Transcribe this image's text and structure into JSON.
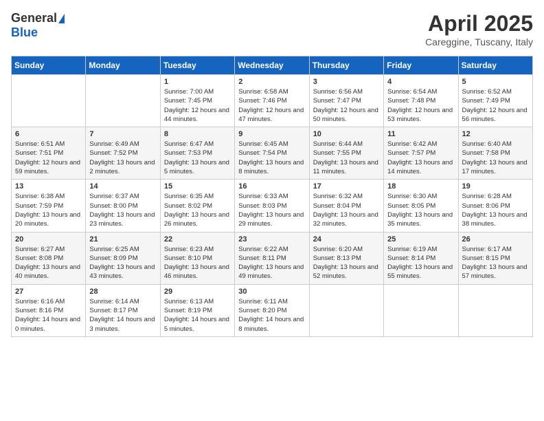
{
  "header": {
    "logo_general": "General",
    "logo_blue": "Blue",
    "title": "April 2025",
    "location": "Careggine, Tuscany, Italy"
  },
  "weekdays": [
    "Sunday",
    "Monday",
    "Tuesday",
    "Wednesday",
    "Thursday",
    "Friday",
    "Saturday"
  ],
  "weeks": [
    [
      {
        "day": "",
        "sunrise": "",
        "sunset": "",
        "daylight": ""
      },
      {
        "day": "",
        "sunrise": "",
        "sunset": "",
        "daylight": ""
      },
      {
        "day": "1",
        "sunrise": "Sunrise: 7:00 AM",
        "sunset": "Sunset: 7:45 PM",
        "daylight": "Daylight: 12 hours and 44 minutes."
      },
      {
        "day": "2",
        "sunrise": "Sunrise: 6:58 AM",
        "sunset": "Sunset: 7:46 PM",
        "daylight": "Daylight: 12 hours and 47 minutes."
      },
      {
        "day": "3",
        "sunrise": "Sunrise: 6:56 AM",
        "sunset": "Sunset: 7:47 PM",
        "daylight": "Daylight: 12 hours and 50 minutes."
      },
      {
        "day": "4",
        "sunrise": "Sunrise: 6:54 AM",
        "sunset": "Sunset: 7:48 PM",
        "daylight": "Daylight: 12 hours and 53 minutes."
      },
      {
        "day": "5",
        "sunrise": "Sunrise: 6:52 AM",
        "sunset": "Sunset: 7:49 PM",
        "daylight": "Daylight: 12 hours and 56 minutes."
      }
    ],
    [
      {
        "day": "6",
        "sunrise": "Sunrise: 6:51 AM",
        "sunset": "Sunset: 7:51 PM",
        "daylight": "Daylight: 12 hours and 59 minutes."
      },
      {
        "day": "7",
        "sunrise": "Sunrise: 6:49 AM",
        "sunset": "Sunset: 7:52 PM",
        "daylight": "Daylight: 13 hours and 2 minutes."
      },
      {
        "day": "8",
        "sunrise": "Sunrise: 6:47 AM",
        "sunset": "Sunset: 7:53 PM",
        "daylight": "Daylight: 13 hours and 5 minutes."
      },
      {
        "day": "9",
        "sunrise": "Sunrise: 6:45 AM",
        "sunset": "Sunset: 7:54 PM",
        "daylight": "Daylight: 13 hours and 8 minutes."
      },
      {
        "day": "10",
        "sunrise": "Sunrise: 6:44 AM",
        "sunset": "Sunset: 7:55 PM",
        "daylight": "Daylight: 13 hours and 11 minutes."
      },
      {
        "day": "11",
        "sunrise": "Sunrise: 6:42 AM",
        "sunset": "Sunset: 7:57 PM",
        "daylight": "Daylight: 13 hours and 14 minutes."
      },
      {
        "day": "12",
        "sunrise": "Sunrise: 6:40 AM",
        "sunset": "Sunset: 7:58 PM",
        "daylight": "Daylight: 13 hours and 17 minutes."
      }
    ],
    [
      {
        "day": "13",
        "sunrise": "Sunrise: 6:38 AM",
        "sunset": "Sunset: 7:59 PM",
        "daylight": "Daylight: 13 hours and 20 minutes."
      },
      {
        "day": "14",
        "sunrise": "Sunrise: 6:37 AM",
        "sunset": "Sunset: 8:00 PM",
        "daylight": "Daylight: 13 hours and 23 minutes."
      },
      {
        "day": "15",
        "sunrise": "Sunrise: 6:35 AM",
        "sunset": "Sunset: 8:02 PM",
        "daylight": "Daylight: 13 hours and 26 minutes."
      },
      {
        "day": "16",
        "sunrise": "Sunrise: 6:33 AM",
        "sunset": "Sunset: 8:03 PM",
        "daylight": "Daylight: 13 hours and 29 minutes."
      },
      {
        "day": "17",
        "sunrise": "Sunrise: 6:32 AM",
        "sunset": "Sunset: 8:04 PM",
        "daylight": "Daylight: 13 hours and 32 minutes."
      },
      {
        "day": "18",
        "sunrise": "Sunrise: 6:30 AM",
        "sunset": "Sunset: 8:05 PM",
        "daylight": "Daylight: 13 hours and 35 minutes."
      },
      {
        "day": "19",
        "sunrise": "Sunrise: 6:28 AM",
        "sunset": "Sunset: 8:06 PM",
        "daylight": "Daylight: 13 hours and 38 minutes."
      }
    ],
    [
      {
        "day": "20",
        "sunrise": "Sunrise: 6:27 AM",
        "sunset": "Sunset: 8:08 PM",
        "daylight": "Daylight: 13 hours and 40 minutes."
      },
      {
        "day": "21",
        "sunrise": "Sunrise: 6:25 AM",
        "sunset": "Sunset: 8:09 PM",
        "daylight": "Daylight: 13 hours and 43 minutes."
      },
      {
        "day": "22",
        "sunrise": "Sunrise: 6:23 AM",
        "sunset": "Sunset: 8:10 PM",
        "daylight": "Daylight: 13 hours and 46 minutes."
      },
      {
        "day": "23",
        "sunrise": "Sunrise: 6:22 AM",
        "sunset": "Sunset: 8:11 PM",
        "daylight": "Daylight: 13 hours and 49 minutes."
      },
      {
        "day": "24",
        "sunrise": "Sunrise: 6:20 AM",
        "sunset": "Sunset: 8:13 PM",
        "daylight": "Daylight: 13 hours and 52 minutes."
      },
      {
        "day": "25",
        "sunrise": "Sunrise: 6:19 AM",
        "sunset": "Sunset: 8:14 PM",
        "daylight": "Daylight: 13 hours and 55 minutes."
      },
      {
        "day": "26",
        "sunrise": "Sunrise: 6:17 AM",
        "sunset": "Sunset: 8:15 PM",
        "daylight": "Daylight: 13 hours and 57 minutes."
      }
    ],
    [
      {
        "day": "27",
        "sunrise": "Sunrise: 6:16 AM",
        "sunset": "Sunset: 8:16 PM",
        "daylight": "Daylight: 14 hours and 0 minutes."
      },
      {
        "day": "28",
        "sunrise": "Sunrise: 6:14 AM",
        "sunset": "Sunset: 8:17 PM",
        "daylight": "Daylight: 14 hours and 3 minutes."
      },
      {
        "day": "29",
        "sunrise": "Sunrise: 6:13 AM",
        "sunset": "Sunset: 8:19 PM",
        "daylight": "Daylight: 14 hours and 5 minutes."
      },
      {
        "day": "30",
        "sunrise": "Sunrise: 6:11 AM",
        "sunset": "Sunset: 8:20 PM",
        "daylight": "Daylight: 14 hours and 8 minutes."
      },
      {
        "day": "",
        "sunrise": "",
        "sunset": "",
        "daylight": ""
      },
      {
        "day": "",
        "sunrise": "",
        "sunset": "",
        "daylight": ""
      },
      {
        "day": "",
        "sunrise": "",
        "sunset": "",
        "daylight": ""
      }
    ]
  ]
}
